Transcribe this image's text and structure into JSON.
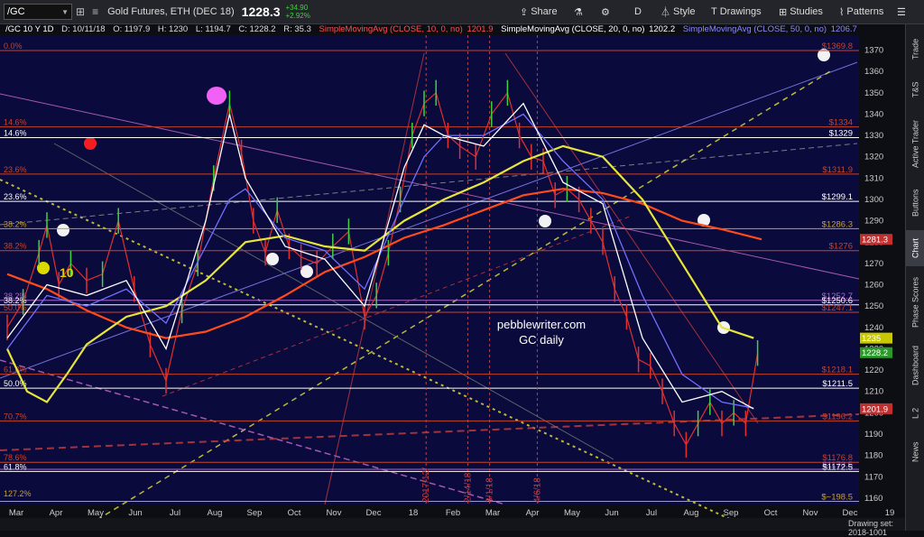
{
  "toolbar": {
    "symbol": "/GC",
    "instrument": "Gold Futures, ETH (DEC 18)",
    "last": "1228.3",
    "change": "+34.90",
    "change_pct": "+2.92%",
    "share_label": "Share",
    "interval_label": "D",
    "style_label": "Style",
    "drawings_label": "Drawings",
    "studies_label": "Studies",
    "patterns_label": "Patterns"
  },
  "header": {
    "symbol": "/GC 10 Y 1D",
    "date": "D: 10/11/18",
    "open": "O: 1197.9",
    "high": "H: 1230",
    "low": "L: 1194.7",
    "close": "C: 1228.2",
    "rsi": "R: 35.3",
    "sma10": "SimpleMovingAvg (CLOSE, 10, 0, no)",
    "sma10_value": "1201.9",
    "sma20": "SimpleMovingAvg (CLOSE, 20, 0, no)",
    "sma20_value": "1202.2",
    "sma50": "SimpleMovingAvg (CLOSE, 50, 0, no)",
    "sma50_value": "1206.7"
  },
  "sidebar_tabs": [
    "Trade",
    "T&S",
    "Active Trader",
    "Buttons",
    "Chart",
    "Phase Scores",
    "Dashboard",
    "L 2",
    "News"
  ],
  "sidebar_active": "Chart",
  "footer": {
    "drawing_set": "Drawing set: 2018-1001"
  },
  "colors": {
    "background": "#0a0a3c",
    "price_up": "#3fd13f",
    "price_down": "#e03030",
    "fib_line": "#c8442a",
    "sma10": "#ffffff",
    "sma20": "#7070ff",
    "sma50": "#e6e63a",
    "sma200": "#ff4a1c"
  },
  "chart_data": {
    "type": "line",
    "title": "pebblewriter.com",
    "subtitle": "GC daily",
    "x_ticks": [
      "Mar",
      "Apr",
      "May",
      "Jun",
      "Jul",
      "Aug",
      "Sep",
      "Oct",
      "Nov",
      "Dec",
      "18",
      "Feb",
      "Mar",
      "Apr",
      "May",
      "Jun",
      "Jul",
      "Aug",
      "Sep",
      "Oct",
      "Nov",
      "Dec",
      "19"
    ],
    "x_tick_index": [
      0,
      1,
      2,
      3,
      4,
      5,
      6,
      7,
      8,
      9,
      10,
      11,
      12,
      13,
      14,
      15,
      16,
      17,
      18,
      19,
      20,
      21,
      22
    ],
    "xlim": [
      0,
      22.7
    ],
    "ylim": [
      1157,
      1377
    ],
    "y_ticks": [
      1160,
      1170,
      1180,
      1190,
      1200,
      1210,
      1220,
      1230,
      1240,
      1250,
      1260,
      1270,
      1280,
      1290,
      1300,
      1310,
      1320,
      1330,
      1340,
      1350,
      1360,
      1370
    ],
    "series": [
      {
        "name": "Close",
        "color": "#e03030",
        "x": [
          0,
          0.4,
          0.8,
          1.0,
          1.3,
          1.6,
          2.0,
          2.4,
          2.8,
          3.2,
          3.6,
          4.0,
          4.4,
          4.8,
          5.2,
          5.6,
          5.9,
          6.2,
          6.5,
          6.8,
          7.1,
          7.4,
          7.8,
          8.2,
          8.6,
          9.0,
          9.3,
          9.6,
          9.9,
          10.2,
          10.5,
          10.8,
          11.1,
          11.4,
          11.8,
          12.2,
          12.6,
          12.9,
          13.2,
          13.5,
          13.8,
          14.1,
          14.4,
          14.7,
          15.0,
          15.3,
          15.6,
          15.9,
          16.2,
          16.5,
          16.8,
          17.1,
          17.4,
          17.7,
          18.0,
          18.3,
          18.6,
          18.9
        ],
        "y": [
          1240,
          1252,
          1275,
          1288,
          1260,
          1270,
          1262,
          1265,
          1290,
          1258,
          1232,
          1215,
          1248,
          1270,
          1310,
          1345,
          1322,
          1290,
          1275,
          1295,
          1278,
          1273,
          1270,
          1278,
          1285,
          1245,
          1255,
          1275,
          1300,
          1330,
          1345,
          1350,
          1330,
          1325,
          1320,
          1340,
          1350,
          1330,
          1320,
          1318,
          1302,
          1305,
          1300,
          1290,
          1280,
          1258,
          1245,
          1225,
          1222,
          1210,
          1195,
          1185,
          1195,
          1205,
          1195,
          1200,
          1195,
          1228
        ]
      },
      {
        "name": "SMA 200",
        "color": "#ff4a1c",
        "x": [
          0,
          1,
          2,
          3,
          4,
          5,
          6,
          7,
          8,
          9,
          10,
          11,
          12,
          13,
          14,
          15,
          16,
          17,
          18,
          19
        ],
        "y": [
          1265,
          1258,
          1248,
          1240,
          1235,
          1238,
          1245,
          1255,
          1266,
          1273,
          1282,
          1288,
          1295,
          1302,
          1305,
          1303,
          1298,
          1290,
          1286,
          1281.3
        ]
      },
      {
        "name": "SMA 50",
        "color": "#e6e63a",
        "x": [
          0,
          0.5,
          1,
          1.5,
          2,
          3,
          4,
          5,
          6,
          7,
          8,
          9,
          10,
          11,
          12,
          13,
          14,
          15,
          16,
          17,
          18,
          18.8
        ],
        "y": [
          1230,
          1210,
          1205,
          1218,
          1232,
          1245,
          1250,
          1262,
          1280,
          1283,
          1278,
          1276,
          1290,
          1300,
          1308,
          1318,
          1325,
          1320,
          1300,
          1270,
          1240,
          1235
        ]
      },
      {
        "name": "SMA 20",
        "color": "#7070ff",
        "x": [
          0,
          1,
          2,
          3,
          4,
          5,
          5.6,
          6,
          7,
          8,
          9,
          10,
          10.5,
          11,
          12,
          13,
          14,
          15,
          16,
          17,
          18,
          18.8
        ],
        "y": [
          1230,
          1255,
          1250,
          1258,
          1242,
          1278,
          1300,
          1305,
          1282,
          1276,
          1258,
          1300,
          1320,
          1330,
          1330,
          1340,
          1318,
          1300,
          1255,
          1218,
          1205,
          1202.2
        ]
      },
      {
        "name": "SMA 10",
        "color": "#ffffff",
        "x": [
          0,
          1,
          2,
          3,
          4,
          5,
          5.6,
          6,
          7,
          8,
          9,
          10,
          10.5,
          11,
          12,
          13,
          14,
          15,
          16,
          17,
          18,
          18.8
        ],
        "y": [
          1235,
          1260,
          1255,
          1262,
          1230,
          1290,
          1340,
          1310,
          1278,
          1272,
          1250,
          1315,
          1335,
          1330,
          1325,
          1345,
          1308,
          1298,
          1235,
          1205,
          1210,
          1201.9
        ]
      }
    ],
    "hlines": [
      {
        "y": 1369.8,
        "label": "$1369.8",
        "color": "#c8442a"
      },
      {
        "y": 1334,
        "label": "$1334",
        "color": "#c8442a"
      },
      {
        "y": 1329,
        "label": "$1329",
        "color": "#ffffff"
      },
      {
        "y": 1311.9,
        "label": "$1311.9",
        "color": "#c8442a"
      },
      {
        "y": 1299.1,
        "label": "$1299.1",
        "color": "#ffffff"
      },
      {
        "y": 1286.3,
        "label": "$1286.3",
        "color": "#c8a030"
      },
      {
        "y": 1276,
        "label": "$1276",
        "color": "#c8442a"
      },
      {
        "y": 1252.7,
        "label": "$1252.7",
        "color": "#aa66cc"
      },
      {
        "y": 1250.6,
        "label": "$1250.6",
        "color": "#ffffff"
      },
      {
        "y": 1247.1,
        "label": "$1247.1",
        "color": "#c8442a"
      },
      {
        "y": 1218.1,
        "label": "$1218.1",
        "color": "#c8442a"
      },
      {
        "y": 1211.5,
        "label": "$1211.5",
        "color": "#ffffff"
      },
      {
        "y": 1196.2,
        "label": "$1196.2",
        "color": "#c8442a"
      },
      {
        "y": 1176.8,
        "label": "$1176.8",
        "color": "#c8442a"
      },
      {
        "y": 1173.5,
        "label": "$1173.5",
        "color": "#aa66cc"
      },
      {
        "y": 1172.5,
        "label": "$1172.5",
        "color": "#ffffff"
      },
      {
        "y": 1158.5,
        "label": "$~198.5",
        "color": "#c8a030"
      }
    ],
    "fib_labels": [
      {
        "y": 1369.8,
        "label": "0.0%",
        "color": "#c8442a"
      },
      {
        "y": 1334,
        "label": "14.6%",
        "color": "#c8442a"
      },
      {
        "y": 1329,
        "label": "14.6%",
        "color": "#ffffff"
      },
      {
        "y": 1311.9,
        "label": "23.6%",
        "color": "#c8442a"
      },
      {
        "y": 1299.1,
        "label": "23.6%",
        "color": "#ffffff"
      },
      {
        "y": 1286.3,
        "label": "38.2%",
        "color": "#c8a030"
      },
      {
        "y": 1276,
        "label": "38.2%",
        "color": "#c8442a"
      },
      {
        "y": 1252.7,
        "label": "38.2%",
        "color": "#aa66cc"
      },
      {
        "y": 1250.6,
        "label": "38.2%",
        "color": "#ffffff"
      },
      {
        "y": 1247.1,
        "label": "50.0%",
        "color": "#c8442a"
      },
      {
        "y": 1218.1,
        "label": "61.8%",
        "color": "#c8442a"
      },
      {
        "y": 1211.5,
        "label": "50.0%",
        "color": "#ffffff"
      },
      {
        "y": 1196.2,
        "label": "70.7%",
        "color": "#c8442a"
      },
      {
        "y": 1176.8,
        "label": "78.6%",
        "color": "#c8442a"
      },
      {
        "y": 1172.5,
        "label": "61.8%",
        "color": "#ffffff"
      },
      {
        "y": 1160,
        "label": "127.2%",
        "color": "#c8a030"
      }
    ],
    "price_tags": [
      {
        "y": 1281.3,
        "label": "1281.3",
        "color": "#c03030"
      },
      {
        "y": 1235,
        "label": "1235",
        "color": "#c8c800"
      },
      {
        "y": 1228.2,
        "label": "1228.2",
        "color": "#2a9a2a"
      },
      {
        "y": 1201.9,
        "label": "1201.9",
        "color": "#c03030"
      }
    ],
    "vlines": [
      {
        "x": 10.55,
        "label": "2017/12/"
      },
      {
        "x": 11.6,
        "label": "2/14/18"
      },
      {
        "x": 12.15,
        "label": "3/1/18"
      },
      {
        "x": 13.35,
        "label": "4/6/18"
      }
    ],
    "annotation": "10",
    "grid": false
  }
}
